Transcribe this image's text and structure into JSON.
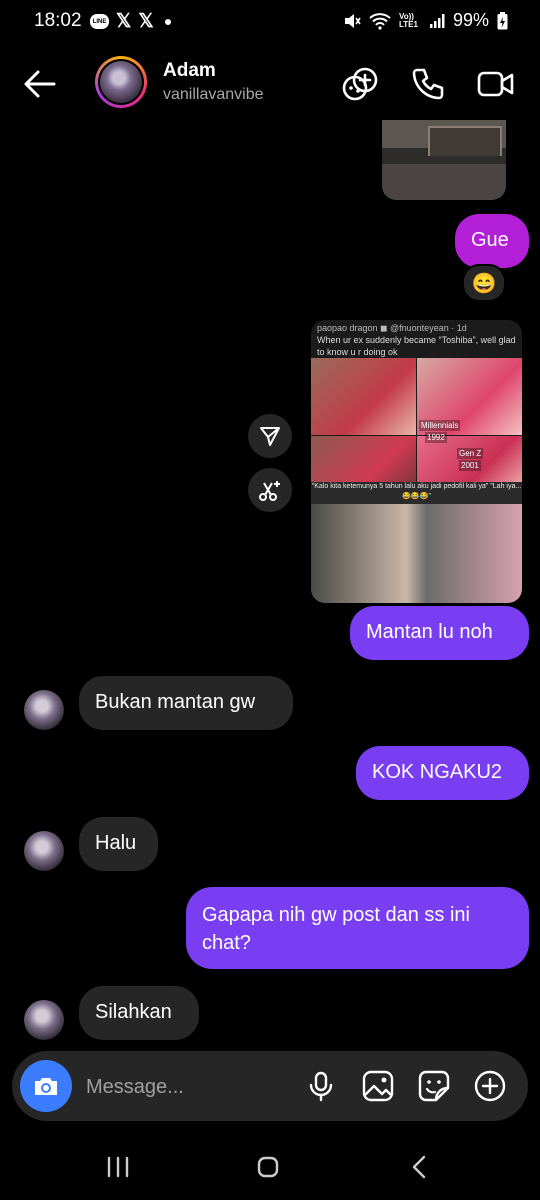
{
  "status_bar": {
    "time": "18:02",
    "line_label": "LINE",
    "x_glyph": "𝕏",
    "network": "Vo)) LTE1",
    "battery": "99%"
  },
  "header": {
    "name": "Adam",
    "username": "vanillavanvibe"
  },
  "meme": {
    "caption_line1": "paopao dragon ◼ @fnuonteyean · 1d",
    "caption_line2": "When ur ex suddenly became “Toshiba”, well glad to know u r doing ok",
    "label_millennials": "Millennials",
    "label_1992": "1992",
    "label_genz": "Gen Z",
    "label_2001": "2001",
    "mid_text": "\"Kalo kita ketemunya 5 tahun lalu aku jadi pedofil kali ya\" \"Lah iya... 😂😂😂\""
  },
  "messages": [
    {
      "from": "me",
      "text": "Gue",
      "reaction": "😄"
    },
    {
      "from": "me",
      "text": "Mantan lu noh"
    },
    {
      "from": "them",
      "text": "Bukan mantan gw"
    },
    {
      "from": "me",
      "text": "KOK NGAKU2"
    },
    {
      "from": "them",
      "text": "Halu"
    },
    {
      "from": "me",
      "text": "Gapapa nih gw post dan ss ini chat?"
    },
    {
      "from": "them",
      "text": "Silahkan"
    }
  ],
  "composer": {
    "placeholder": "Message..."
  },
  "icons": {
    "header": [
      "back-arrow-icon",
      "add-effect-icon",
      "phone-icon",
      "video-icon"
    ],
    "composer": [
      "camera-icon",
      "microphone-icon",
      "gallery-icon",
      "sticker-icon",
      "plus-circle-icon"
    ],
    "media_actions": [
      "share-icon",
      "remix-icon"
    ]
  },
  "colors": {
    "outgoing_bubble": "#7a3ef2",
    "outgoing_bubble_pink": "#b21fd6",
    "incoming_bubble": "#262626",
    "camera_button": "#3c7cff"
  }
}
